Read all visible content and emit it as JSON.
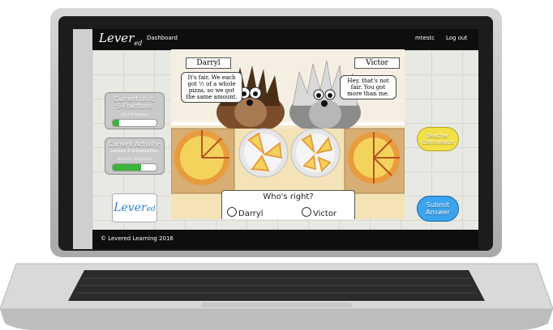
{
  "topbar": {
    "brand_main": "Lever",
    "brand_sub": "ed",
    "dashboard": "Dashboard",
    "user": "mtestc",
    "logout": "Log out"
  },
  "sidebar": {
    "unit_title_1": "Current Unit:",
    "unit_title_2": "5-Fractions",
    "unit_progress_label": "Unit Progress",
    "unit_progress": 0.15,
    "activity_title_1": "Current Activity:",
    "activity_title_2": "Lesson 2-Introduction",
    "activity_progress_label": "Activity Progress",
    "activity_progress": 0.65
  },
  "actions": {
    "teacher_1": "Teacher",
    "teacher_2": "Conference",
    "submit_1": "Submit",
    "submit_2": "Answer"
  },
  "scene": {
    "left_name": "Darryl",
    "right_name": "Victor",
    "left_speech_1": "It's fair. We each",
    "left_speech_2": "got ½ of a whole",
    "left_speech_3": "pizza, so we got",
    "left_speech_4": "the same amount.",
    "right_speech_1": "Hey, that's not",
    "right_speech_2": "fair. You got",
    "right_speech_3": "more than me.",
    "question": "Who's right?",
    "option_1": "Darryl",
    "option_2": "Victor"
  },
  "footer": {
    "text": "© Levered Learning 2016"
  },
  "colors": {
    "teacher": "#f2e04a",
    "submit": "#3ba4ee",
    "progress": "#3cb43c"
  }
}
